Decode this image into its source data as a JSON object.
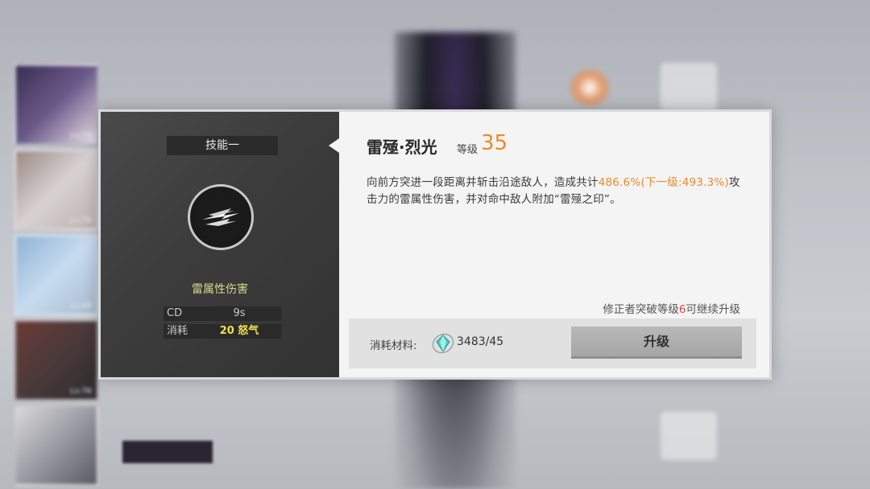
{
  "background": {
    "portraits": [
      {
        "level": "Lv.76"
      },
      {
        "level": "Lv.76"
      },
      {
        "level": "Lv.48"
      },
      {
        "level": "Lv.76"
      },
      {
        "level": ""
      }
    ]
  },
  "dialog": {
    "skill_slot": "技能一",
    "element": "雷属性伤害",
    "stats": [
      {
        "key": "CD",
        "value": "9s"
      },
      {
        "key": "消耗",
        "value": "20 怒气"
      }
    ],
    "skill_name": "雷殛·烈光",
    "level_label": "等级",
    "level_value": "35",
    "description": {
      "part1": "向前方突进一段距离并斩击沿途敌人，造成共计",
      "highlight": "486.6%(下一级:493.3%)",
      "part2": "攻击力的雷属性伤害，并对命中敌人附加“雷殛之印”。"
    },
    "breakthrough": {
      "prefix": "修正者突破等级",
      "required": "6",
      "suffix": "可继续升级"
    },
    "material": {
      "label": "消耗材料:",
      "count": "3483/45"
    },
    "upgrade_button": "升级"
  },
  "colors": {
    "accent_orange": "#f0882a",
    "requirement_red": "#e0463b",
    "element_yellow": "#d6d88a",
    "cost_yellow": "#f2e14a"
  }
}
